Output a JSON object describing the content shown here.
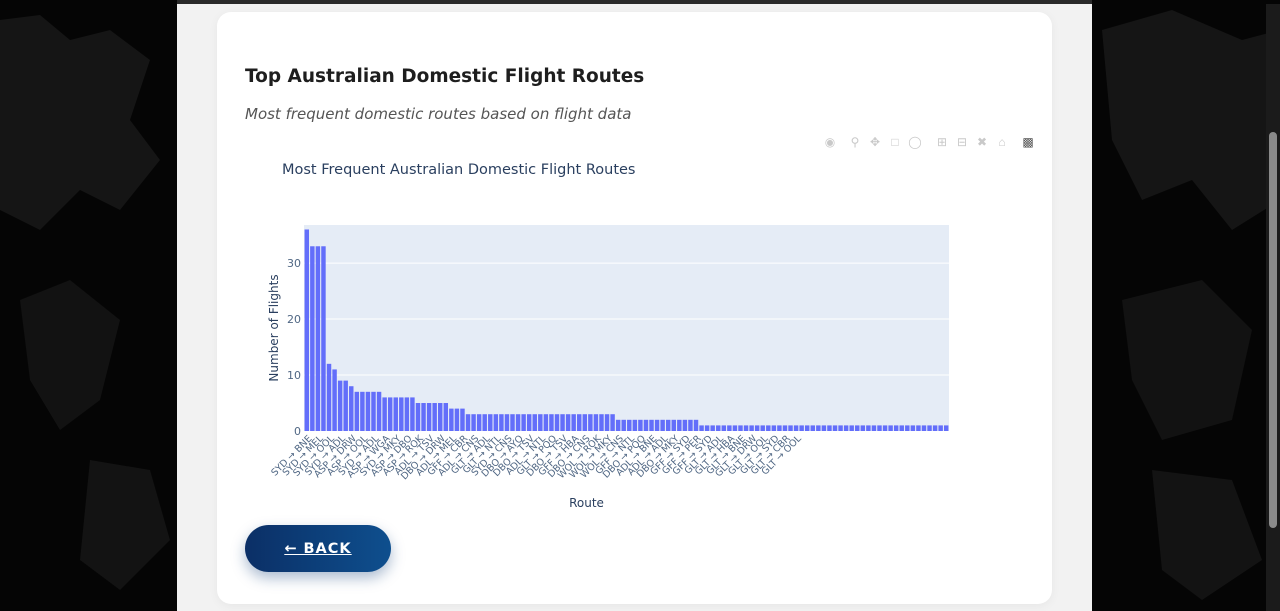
{
  "page": {
    "title": "Top Australian Domestic Flight Routes",
    "subtitle": "Most frequent domestic routes based on flight data",
    "back_label": "← BACK"
  },
  "modebar": {
    "icons": [
      "camera-icon",
      "zoom-icon",
      "pan-icon",
      "box-select-icon",
      "lasso-icon",
      "zoom-in-icon",
      "zoom-out-icon",
      "autoscale-icon",
      "home-icon",
      "plotly-logo-icon"
    ]
  },
  "colors": {
    "bar": "#636efa",
    "plot_bg": "#e5ecf6",
    "text": "#2a3f5f",
    "button": "#0b3a78"
  },
  "chart_data": {
    "type": "bar",
    "title": "Most Frequent Australian Domestic Flight Routes",
    "xlabel": "Route",
    "ylabel": "Number of Flights",
    "ylim": [
      0,
      36.8
    ],
    "yticks": [
      0,
      10,
      20,
      30
    ],
    "grid": true,
    "categories": [
      "SYD → BNE",
      "SYD → MEL",
      "SYD → OOL",
      "SYD → ADL",
      "ASP → DRW",
      "ASP → OOL",
      "SYD → ADL",
      "ASP → WGA",
      "SYD → MKY",
      "ASP → DBO",
      "ASP → ROK",
      "ADL → TSV",
      "DBO → DRW",
      "ADL → MEL",
      "GFF → CBR",
      "ADL → CNS",
      "GLT → ADL",
      "GLT → NTL",
      "SYD → CNS",
      "DBO → AYQ",
      "DBO → TSV",
      "ADL → NTL",
      "GLT → PQQ",
      "DBO → TSV",
      "GFF → HBA",
      "DBO → CNS",
      "WOL → ROK",
      "WOL → MKY",
      "WOL → CNS",
      "GFF → NTL",
      "DBO → PQQ",
      "ADL → BNE",
      "ADL → ADL",
      "DBO → MKY",
      "GFF → SYD",
      "GFF → PER",
      "GFF → SYD",
      "GLT → ADL",
      "GLT → HBA",
      "GLT → BNE",
      "GLT → DRW",
      "GLT → OOL",
      "GLT → SYD",
      "GLT → CBR",
      "GLT → OOL"
    ],
    "values": [
      36,
      33,
      33,
      33,
      12,
      11,
      9,
      9,
      8,
      7,
      7,
      7,
      7,
      7,
      6,
      6,
      6,
      6,
      6,
      6,
      5,
      5,
      5,
      5,
      5,
      5,
      4,
      4,
      4,
      3,
      3,
      3,
      3,
      3,
      3,
      3,
      3,
      3,
      3,
      3,
      3,
      3,
      3,
      3,
      3,
      3,
      3,
      3,
      3,
      3,
      3,
      3,
      3,
      3,
      3,
      3,
      2,
      2,
      2,
      2,
      2,
      2,
      2,
      2,
      2,
      2,
      2,
      2,
      2,
      2,
      2,
      1,
      1,
      1,
      1,
      1,
      1,
      1,
      1,
      1,
      1,
      1,
      1,
      1,
      1,
      1,
      1,
      1,
      1,
      1,
      1,
      1,
      1,
      1,
      1,
      1,
      1,
      1,
      1,
      1,
      1,
      1,
      1,
      1,
      1,
      1,
      1,
      1,
      1,
      1,
      1,
      1,
      1,
      1,
      1,
      1
    ]
  }
}
